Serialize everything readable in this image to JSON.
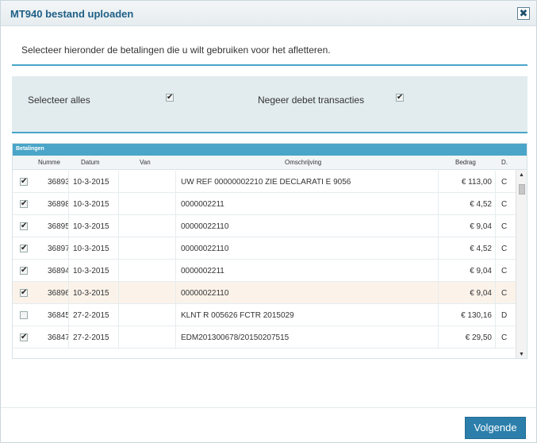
{
  "dialog": {
    "title": "MT940 bestand uploaden",
    "close_label": "✖"
  },
  "intro": "Selecteer hieronder de betalingen die u wilt gebruiken voor het afletteren.",
  "selection": {
    "select_all_label": "Selecteer alles",
    "select_all_checked": true,
    "ignore_debit_label": "Negeer debet transacties",
    "ignore_debit_checked": true
  },
  "grid": {
    "caption": "Betalingen",
    "columns": [
      "Numme",
      "Datum",
      "Van",
      "Omschrijving",
      "Bedrag",
      "D."
    ],
    "rows": [
      {
        "checked": true,
        "number": "36893",
        "date": "10-3-2015",
        "from": "",
        "description": "UW REF  00000002210    ZIE DECLARATI E 9056",
        "amount": "€ 113,00",
        "dc": "C"
      },
      {
        "checked": true,
        "number": "36898",
        "date": "10-3-2015",
        "from": "",
        "description": "0000002211",
        "amount": "€ 4,52",
        "dc": "C"
      },
      {
        "checked": true,
        "number": "36895",
        "date": "10-3-2015",
        "from": "",
        "description": "00000022110",
        "amount": "€ 9,04",
        "dc": "C"
      },
      {
        "checked": true,
        "number": "36897",
        "date": "10-3-2015",
        "from": "",
        "description": "00000022110",
        "amount": "€ 4,52",
        "dc": "C"
      },
      {
        "checked": true,
        "number": "36894",
        "date": "10-3-2015",
        "from": "",
        "description": "0000002211",
        "amount": "€ 9,04",
        "dc": "C"
      },
      {
        "checked": true,
        "number": "36896",
        "date": "10-3-2015",
        "from": "",
        "description": "00000022110",
        "amount": "€ 9,04",
        "dc": "C"
      },
      {
        "checked": false,
        "number": "36845",
        "date": "27-2-2015",
        "from": "",
        "description": "KLNT R    005626 FCTR 2015029",
        "amount": "€ 130,16",
        "dc": "D"
      },
      {
        "checked": true,
        "number": "36847",
        "date": "27-2-2015",
        "from": "",
        "description": "EDM201300678/20150207515",
        "amount": "€ 29,50",
        "dc": "C"
      }
    ],
    "highlight_row": 5
  },
  "footer": {
    "next_label": "Volgende"
  },
  "colors": {
    "accent": "#4aa5c8",
    "button": "#2c7fab",
    "title_text": "#1f5f86",
    "panel_bg": "#e2ecef",
    "highlight_row": "#fbf3ea"
  },
  "icons": {
    "close": "close-icon",
    "checkbox": "checkbox-icon",
    "scroll_up": "scroll-up-icon",
    "scroll_down": "scroll-down-icon"
  }
}
